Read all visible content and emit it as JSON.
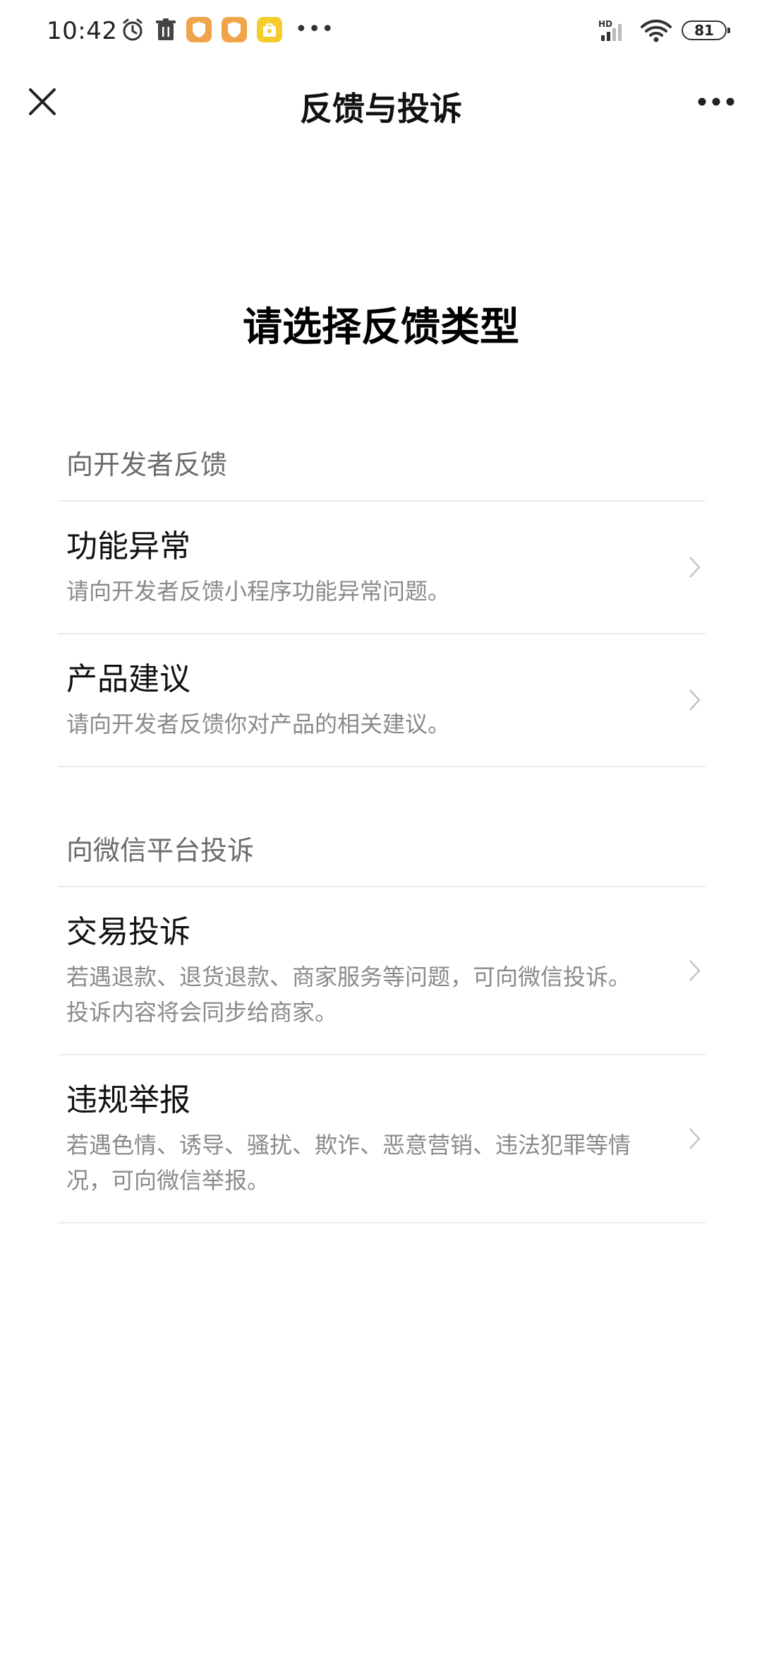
{
  "status_bar": {
    "time": "10:42",
    "battery": "81",
    "network": "HD"
  },
  "nav": {
    "title": "反馈与投诉"
  },
  "headline": "请选择反馈类型",
  "sections": [
    {
      "header": "向开发者反馈",
      "items": [
        {
          "title": "功能异常",
          "desc": "请向开发者反馈小程序功能异常问题。"
        },
        {
          "title": "产品建议",
          "desc": "请向开发者反馈你对产品的相关建议。"
        }
      ]
    },
    {
      "header": "向微信平台投诉",
      "items": [
        {
          "title": "交易投诉",
          "desc": "若遇退款、退货退款、商家服务等问题，可向微信投诉。投诉内容将会同步给商家。"
        },
        {
          "title": "违规举报",
          "desc": "若遇色情、诱导、骚扰、欺诈、恶意营销、违法犯罪等情况，可向微信举报。"
        }
      ]
    }
  ],
  "colors": {
    "app_badge_orange": "#f0a44a",
    "app_badge_yellow": "#f5cc2e",
    "divider": "#ececec",
    "section_header_text": "#6b6b6b",
    "desc_text": "#8a8a8a"
  },
  "icons": {
    "close": "close-icon",
    "more": "more-icon",
    "chevron": "chevron-right-icon"
  }
}
